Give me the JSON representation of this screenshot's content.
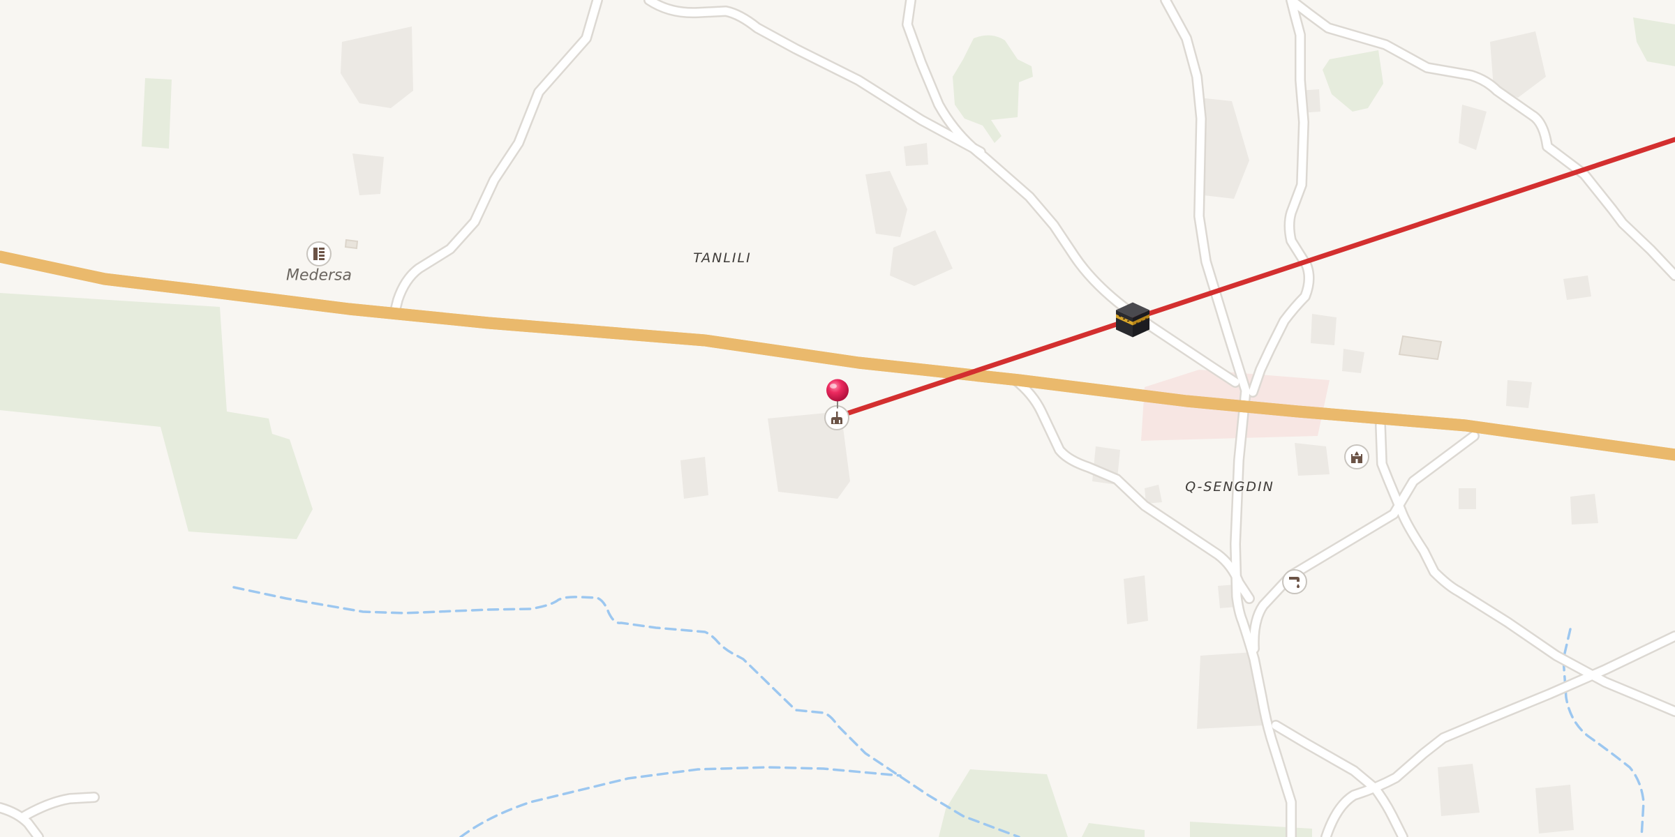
{
  "map": {
    "places": [
      {
        "id": "tanlili",
        "name": "TANLILI"
      },
      {
        "id": "q-sengdin",
        "name": "Q-SENGDIN"
      }
    ],
    "pois": [
      {
        "id": "medersa",
        "name": "Medersa",
        "icon": "school-icon"
      },
      {
        "id": "mosque-pin",
        "name": "",
        "icon": "mosque-icon"
      },
      {
        "id": "mosque-east",
        "name": "",
        "icon": "mosque-icon"
      },
      {
        "id": "water-tap",
        "name": "",
        "icon": "water-tap-icon"
      }
    ],
    "markers": {
      "selected_pin": {
        "icon": "red-pin-icon",
        "color": "#e8245a"
      },
      "qibla_destination": {
        "icon": "kaaba-icon"
      }
    },
    "qibla_line": {
      "color": "#d32f2f"
    },
    "colors": {
      "background": "#f8f6f2",
      "main_road": "#f9e3a6",
      "main_road_casing": "#eab96c",
      "minor_road": "#ffffff",
      "minor_road_casing": "#dcd8d2",
      "green_area": "#e6ecdd",
      "stream": "#9cc7f0",
      "building": "#ece9e4",
      "landuse_pink": "#f7e6e3"
    }
  }
}
